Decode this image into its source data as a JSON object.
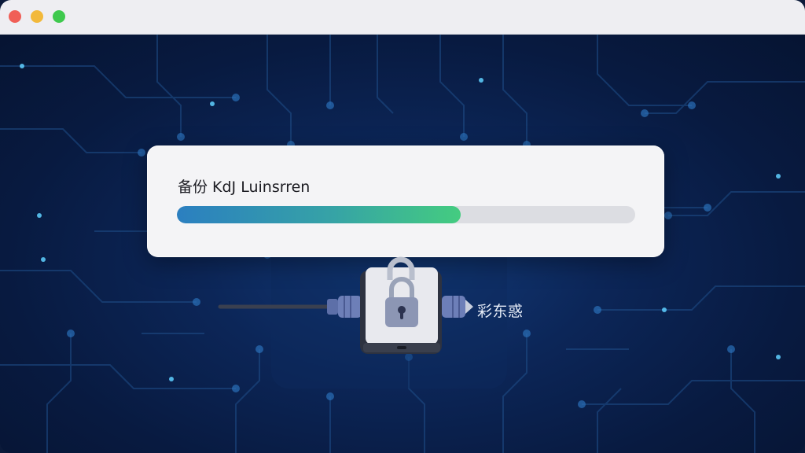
{
  "window": {
    "controls": [
      "close",
      "minimize",
      "zoom"
    ]
  },
  "backup_card": {
    "title": "备份 KdJ Luinsrren",
    "progress_fraction": 0.62,
    "progress_colors": {
      "start": "#2b7fc0",
      "end": "#44cc80"
    }
  },
  "drive": {
    "side_label": "彩东惑",
    "icons": [
      "cable-icon",
      "hard-drive-icon",
      "padlock-icon"
    ]
  },
  "colors": {
    "background": "#0a1836",
    "circuit": "#1f4f8a",
    "card": "#f4f4f6"
  }
}
